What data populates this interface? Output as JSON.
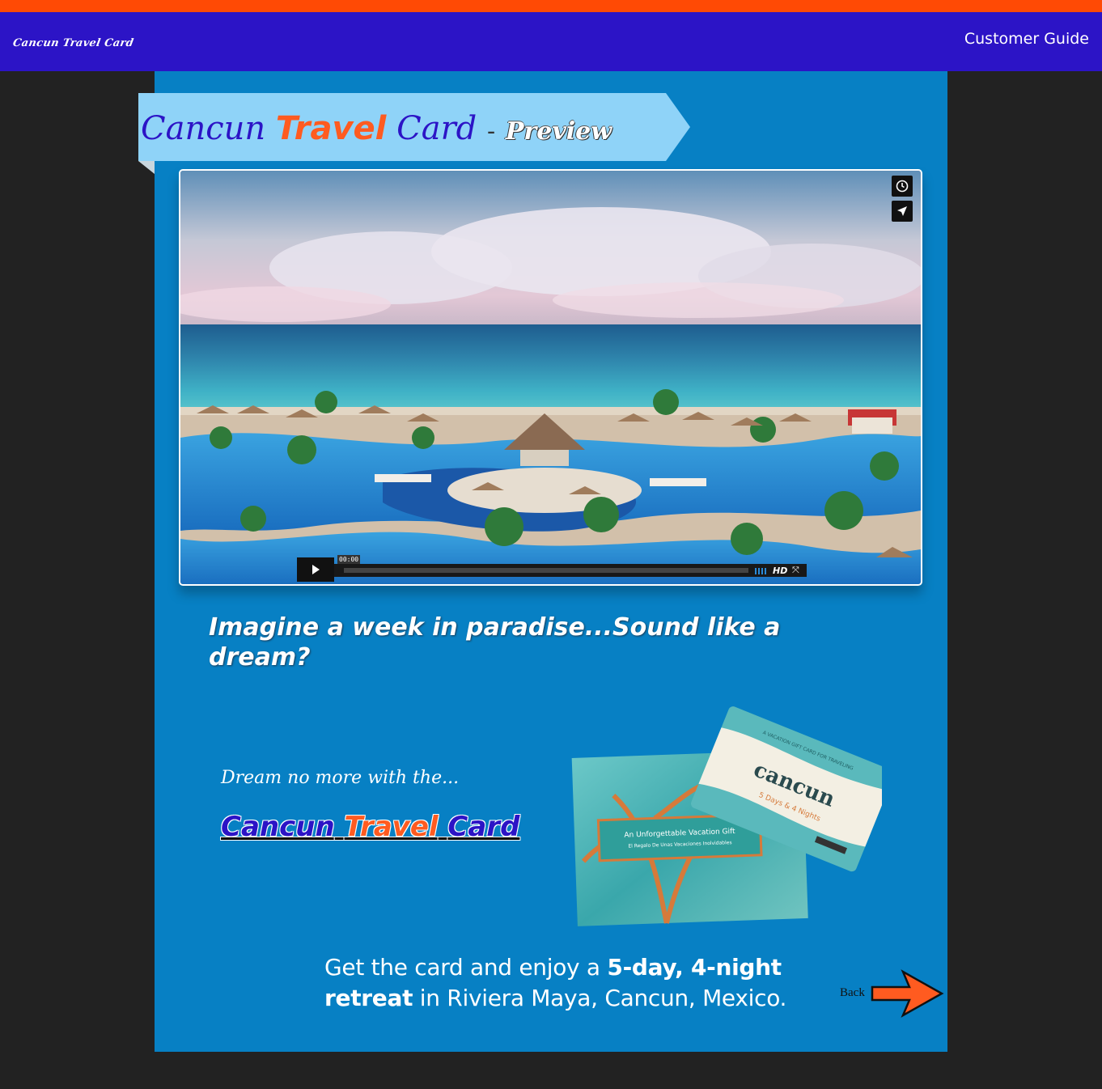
{
  "header": {
    "brand": "Cancun Travel Card",
    "nav_link": "Customer Guide"
  },
  "ribbon": {
    "title_word1": "Cancun",
    "title_word2": "Travel",
    "title_word3": "Card",
    "separator": "-",
    "suffix": "Preview"
  },
  "video": {
    "timecode": "00:00",
    "quality_label": "HD",
    "progress": 0.0,
    "top_controls": [
      {
        "icon": "clock-icon"
      },
      {
        "icon": "send-icon"
      }
    ]
  },
  "content": {
    "headline": "Imagine a week in paradise...Sound like a dream?",
    "dream_text": "Dream no more with the...",
    "brand_link": {
      "w1": "Cancun",
      "w2": "Travel",
      "w3": "Card"
    },
    "card_image": {
      "back_card_label": "An Unforgettable Vacation Gift",
      "back_card_sub": "El Regalo De Unas Vacaciones Inolvidables",
      "front_card_brand": "cancun",
      "front_card_sub": "5 Days & 4 Nights",
      "front_card_tagline": "A VACATION GIFT CARD FOR TRAVELING"
    },
    "retreat_pre": "Get the card and enjoy a",
    "retreat_bold": "5-day, 4-night retreat",
    "retreat_post": "in Riviera Maya, Cancun, Mexico.",
    "back_label": "Back"
  },
  "colors": {
    "top_stripe": "#ff4a05",
    "navbar": "#2c14c6",
    "panel": "#0780c4",
    "ribbon": "#8fd3f8",
    "accent_orange": "#ff5b20",
    "background": "#222222"
  }
}
